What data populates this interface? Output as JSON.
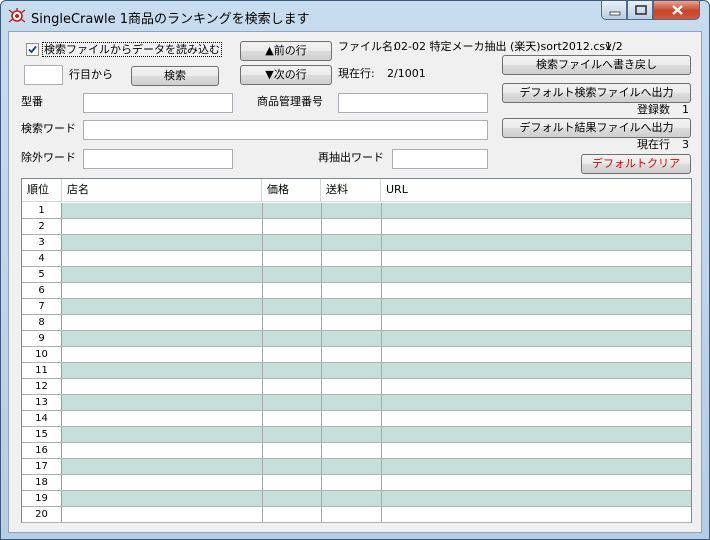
{
  "window": {
    "title": "SingleCrawle 1商品のランキングを検索します"
  },
  "top": {
    "checkbox_label": "検索ファイルからデータを読み込む",
    "checkbox_checked": true,
    "start_row_value": "",
    "start_row_suffix": "行目から",
    "search_button": "検索",
    "prev_button": "▲前の行",
    "next_button": "▼次の行",
    "file_label": "ファイル名:",
    "file_value": "02-02 特定メーカ抽出 (楽天)sort2012.csv",
    "file_page": "1/2",
    "current_row_label": "現在行:",
    "current_row_value": "2/1001"
  },
  "right": {
    "writeback_button": "検索ファイルへ書き戻し",
    "export_search_button": "デフォルト検索ファイルへ出力",
    "registered_label": "登録数",
    "registered_value": "1",
    "export_result_button": "デフォルト結果ファイルへ出力",
    "current_row2_label": "現在行",
    "current_row2_value": "3",
    "clear_button": "デフォルトクリア",
    "clear_color": "#e00000"
  },
  "fields": {
    "model_label": "型番",
    "model_value": "",
    "product_code_label": "商品管理番号",
    "product_code_value": "",
    "keyword_label": "検索ワード",
    "keyword_value": "",
    "exclude_label": "除外ワード",
    "exclude_value": "",
    "re_extract_label": "再抽出ワード",
    "re_extract_value": ""
  },
  "grid": {
    "columns": [
      "順位",
      "店名",
      "価格",
      "送料",
      "URL"
    ],
    "rows": [
      "1",
      "2",
      "3",
      "4",
      "5",
      "6",
      "7",
      "8",
      "9",
      "10",
      "11",
      "12",
      "13",
      "14",
      "15",
      "16",
      "17",
      "18",
      "19",
      "20"
    ],
    "alt_row_color": "#c7dfdb"
  }
}
